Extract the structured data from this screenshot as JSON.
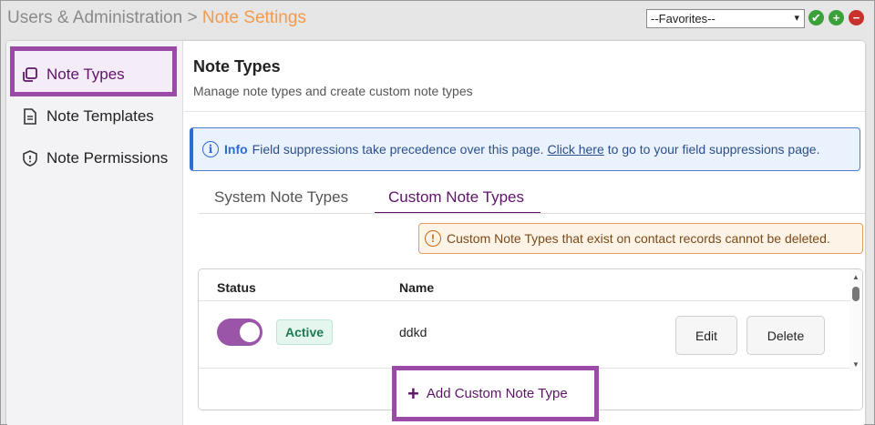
{
  "breadcrumb": {
    "parent": "Users & Administration",
    "separator": ">",
    "current": "Note Settings"
  },
  "favorites": {
    "selected": "--Favorites--",
    "arrow": "▾"
  },
  "header_actions": {
    "ok_glyph": "✔",
    "add_glyph": "+",
    "remove_glyph": "−",
    "ok_color": "#3aa03a",
    "remove_color": "#c8322c"
  },
  "sidebar": {
    "items": [
      {
        "label": "Note Types",
        "icon": "note-types-icon"
      },
      {
        "label": "Note Templates",
        "icon": "document-icon"
      },
      {
        "label": "Note Permissions",
        "icon": "shield-icon"
      }
    ]
  },
  "main": {
    "title": "Note Types",
    "subtitle": "Manage note types and create custom note types"
  },
  "info": {
    "icon_glyph": "i",
    "label": "Info",
    "text_before": "Field suppressions take precedence over this page.",
    "link": "Click here",
    "text_after": "to go to your field suppressions page."
  },
  "tabs": {
    "system": "System Note Types",
    "custom": "Custom Note Types"
  },
  "warning": {
    "icon_glyph": "!",
    "text": "Custom Note Types that exist on contact records cannot be deleted."
  },
  "table": {
    "headers": {
      "status": "Status",
      "name": "Name"
    },
    "rows": [
      {
        "status": "Active",
        "name": "ddkd",
        "enabled": true,
        "edit": "Edit",
        "delete": "Delete"
      }
    ]
  },
  "add_button": {
    "glyph": "+",
    "label": "Add Custom Note Type"
  },
  "colors": {
    "accent": "#5f1469",
    "highlight": "#9b4aa8",
    "breadcrumb_current": "#f39a4c",
    "info": "#2f6bd3",
    "warning": "#c86a1a",
    "active": "#1f7a52"
  }
}
